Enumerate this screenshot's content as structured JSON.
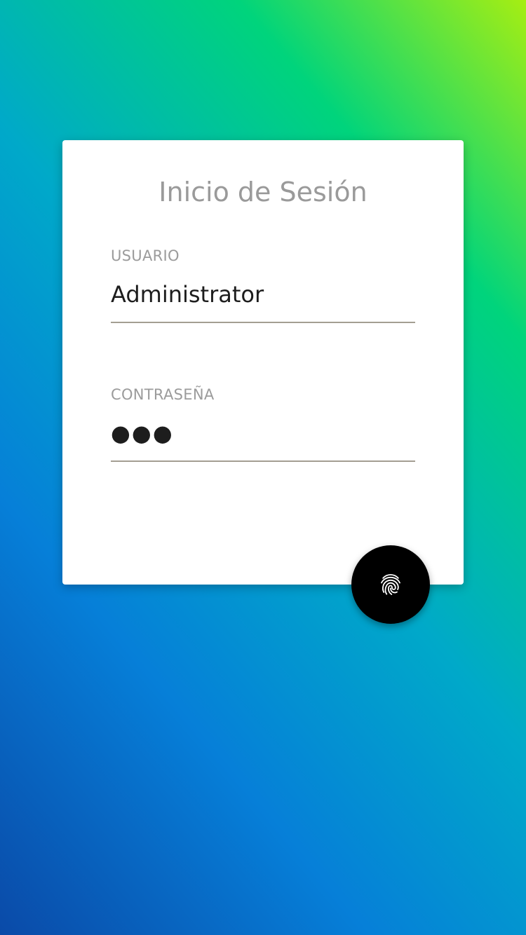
{
  "login": {
    "title": "Inicio de Sesión",
    "username": {
      "label": "USUARIO",
      "value": "Administrator"
    },
    "password": {
      "label": "CONTRASEÑA",
      "value": "●●●"
    },
    "fingerprint_button": {
      "icon": "fingerprint-icon"
    }
  },
  "colors": {
    "gradient": [
      "#0a4aa8",
      "#067fd8",
      "#00a9c9",
      "#00d47c",
      "#a6ee12"
    ],
    "card": "#ffffff",
    "fab": "#000000",
    "label": "#9b9b9b",
    "underline": "#a39e92"
  }
}
